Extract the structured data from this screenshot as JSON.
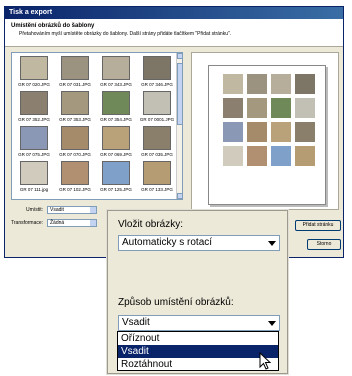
{
  "window": {
    "title": "Tisk a export"
  },
  "header": {
    "title": "Umístění obrázků do šablony",
    "description": "Přetahováním myší umístěte obrázky do šablony. Další strány přidáte tlačítkem \"Přidat stránku\"."
  },
  "thumbnails": [
    {
      "caption": "GR 07 020.JPG",
      "color": "#c0b8a0"
    },
    {
      "caption": "GR 07 031.JPG",
      "color": "#9c9280"
    },
    {
      "caption": "GR 07 343.JPG",
      "color": "#b6ad9b"
    },
    {
      "caption": "GR 07 346.JPG",
      "color": "#7d7566"
    },
    {
      "caption": "GR 07 352.JPG",
      "color": "#8b8070"
    },
    {
      "caption": "GR 07 353.JPG",
      "color": "#a4987f"
    },
    {
      "caption": "GR 07 354.JPG",
      "color": "#6f8a58"
    },
    {
      "caption": "GR 07 0001.JPG",
      "color": "#c2c0b4"
    },
    {
      "caption": "GR 07 075.JPG",
      "color": "#8a98b6"
    },
    {
      "caption": "GR 07 070.JPG",
      "color": "#a58b6a"
    },
    {
      "caption": "GR 07 069.JPG",
      "color": "#b9a27a"
    },
    {
      "caption": "GR 07 035.JPG",
      "color": "#8a7f6b"
    },
    {
      "caption": "GR 07 111.jpg",
      "color": "#d0cbbd"
    },
    {
      "caption": "GR 07 102.JPG",
      "color": "#b09070"
    },
    {
      "caption": "GR 07 125.JPG",
      "color": "#7fa0c8"
    },
    {
      "caption": "GR 07 133.JPG",
      "color": "#b59c72"
    }
  ],
  "form": {
    "insert_label": "Umístit:",
    "insert_value": "Vsadit",
    "transform_label": "Transformace:",
    "transform_value": "Žádná"
  },
  "preview_colors": [
    "#c0b8a0",
    "#9c9280",
    "#b6ad9b",
    "#7d7566",
    "#8b8070",
    "#a4987f",
    "#6f8a58",
    "#c2c0b4",
    "#8a98b6",
    "#a58b6a",
    "#b9a27a",
    "#8a7f6b",
    "#d0cbbd",
    "#b09070",
    "#7fa0c8",
    "#b59c72"
  ],
  "buttons": {
    "add_page": "Přidat stránku",
    "close": "Storno"
  },
  "zoom": {
    "insert_images_label": "Vložit obrázky:",
    "insert_images_value": "Automaticky s rotací",
    "placement_label": "Způsob umístění obrázků:",
    "placement_value": "Vsadit",
    "options": [
      "Oříznout",
      "Vsadit",
      "Roztáhnout"
    ],
    "selected_option": "Vsadit"
  }
}
